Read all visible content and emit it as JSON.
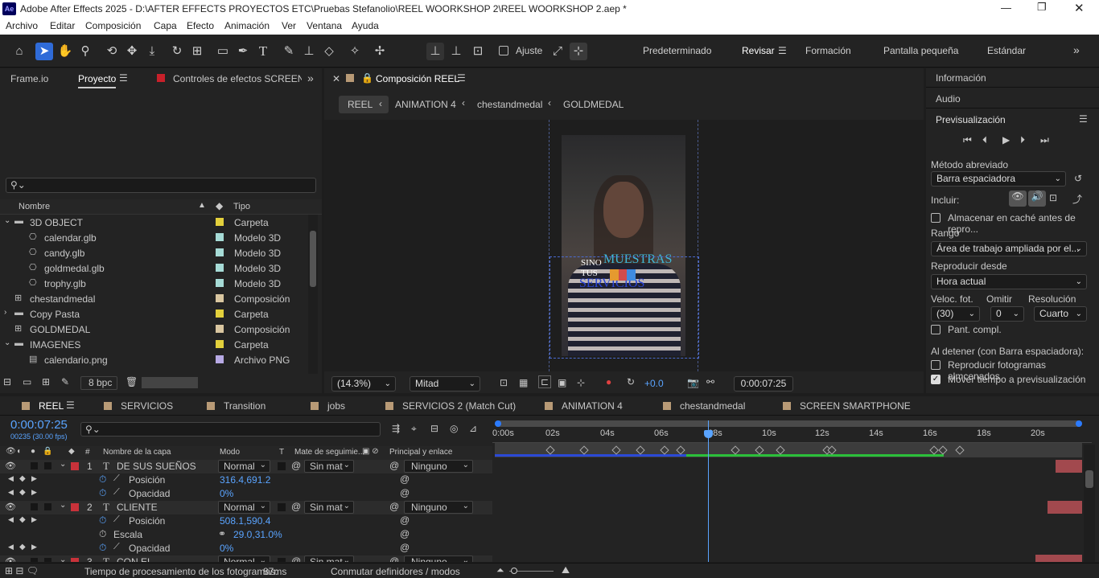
{
  "window": {
    "title": "Adobe After Effects 2025 - D:\\AFTER EFFECTS PROYECTOS ETC\\Pruebas Stefanolio\\REEL WOORKSHOP 2\\REEL WOORKSHOP 2.aep *",
    "app_badge": "Ae"
  },
  "menu": [
    "Archivo",
    "Editar",
    "Composición",
    "Capa",
    "Efecto",
    "Animación",
    "Ver",
    "Ventana",
    "Ayuda"
  ],
  "toolbar": {
    "snap_label": "Ajuste",
    "workspaces": [
      "Predeterminado",
      "Revisar",
      "Formación",
      "Pantalla pequeña",
      "Estándar"
    ],
    "active_workspace": "Revisar"
  },
  "project": {
    "tabs": [
      "Frame.io",
      "Proyecto",
      "Controles de efectos SCREEN SMA"
    ],
    "active_tab": "Proyecto",
    "search_placeholder": "",
    "col_name": "Nombre",
    "col_type": "Tipo",
    "items": [
      {
        "name": "3D OBJECT",
        "type": "Carpeta",
        "color": "#e3d03c",
        "indent": 0,
        "expand": "open",
        "icon": "folder-icon"
      },
      {
        "name": "calendar.glb",
        "type": "Modelo 3D",
        "color": "#a6dbd6",
        "indent": 1,
        "expand": "",
        "icon": "model-icon"
      },
      {
        "name": "candy.glb",
        "type": "Modelo 3D",
        "color": "#a6dbd6",
        "indent": 1,
        "expand": "",
        "icon": "model-icon"
      },
      {
        "name": "goldmedal.glb",
        "type": "Modelo 3D",
        "color": "#a6dbd6",
        "indent": 1,
        "expand": "",
        "icon": "model-icon"
      },
      {
        "name": "trophy.glb",
        "type": "Modelo 3D",
        "color": "#a6dbd6",
        "indent": 1,
        "expand": "",
        "icon": "model-icon"
      },
      {
        "name": "chestandmedal",
        "type": "Composición",
        "color": "#d9c6a0",
        "indent": 0,
        "expand": "",
        "icon": "comp-icon"
      },
      {
        "name": "Copy Pasta",
        "type": "Carpeta",
        "color": "#e3d03c",
        "indent": 0,
        "expand": "closed",
        "icon": "folder-icon"
      },
      {
        "name": "GOLDMEDAL",
        "type": "Composición",
        "color": "#d9c6a0",
        "indent": 0,
        "expand": "",
        "icon": "comp-icon"
      },
      {
        "name": "IMAGENES",
        "type": "Carpeta",
        "color": "#e3d03c",
        "indent": 0,
        "expand": "open",
        "icon": "folder-icon"
      },
      {
        "name": "calendario.png",
        "type": "Archivo PNG",
        "color": "#b7a9e4",
        "indent": 1,
        "expand": "",
        "icon": "image-icon"
      }
    ],
    "bpc": "8 bpc"
  },
  "composition": {
    "tab_title": "Composición REEL",
    "breadcrumbs": [
      "REEL",
      "ANIMATION 4",
      "chestandmedal",
      "GOLDMEDAL"
    ],
    "overlay_text": {
      "line1": "SINO",
      "line2": "TUS",
      "muestras": "MUESTRAS",
      "servicios": "SERVICIOS"
    },
    "zoom": "(14.3%)",
    "resolution": "Mitad",
    "exposure": "+0.0",
    "timecode": "0:00:07:25"
  },
  "right_panel": {
    "items": [
      "Información",
      "Audio"
    ],
    "preview_title": "Previsualización",
    "shortcut_label": "Método abreviado",
    "shortcut_value": "Barra espaciadora",
    "include_label": "Incluir:",
    "cache_label": "Almacenar en caché antes de repro...",
    "range_label": "Rango",
    "range_value": "Área de trabajo ampliada por el...",
    "play_from_label": "Reproducir desde",
    "play_from_value": "Hora actual",
    "fps_label": "Veloc. fot.",
    "skip_label": "Omitir",
    "res_label": "Resolución",
    "fps_value": "(30)",
    "skip_value": "0",
    "res_value": "Cuarto",
    "fullscreen_label": "Pant. compl.",
    "on_stop_label": "Al detener (con Barra espaciadora):",
    "cached_frames_label": "Reproducir fotogramas almcenados",
    "move_time_label": "Mover tiempo a previsualización"
  },
  "timeline": {
    "tabs": [
      {
        "name": "REEL",
        "color": "#b89a76"
      },
      {
        "name": "SERVICIOS",
        "color": "#b89a76"
      },
      {
        "name": "Transition",
        "color": "#b89a76"
      },
      {
        "name": "jobs",
        "color": "#b89a76"
      },
      {
        "name": "SERVICIOS 2 (Match Cut)",
        "color": "#b89a76"
      },
      {
        "name": "ANIMATION 4",
        "color": "#b89a76"
      },
      {
        "name": "chestandmedal",
        "color": "#b89a76"
      },
      {
        "name": "SCREEN SMARTPHONE",
        "color": "#b89a76"
      }
    ],
    "timecode": "0:00:07:25",
    "frame_info": "00235 (30.00 fps)",
    "col_layer": "Nombre de la capa",
    "col_mode": "Modo",
    "col_t": "T",
    "col_track": "Mate de seguimie...",
    "col_parent": "Principal y enlace",
    "ruler": [
      "0:00s",
      "02s",
      "04s",
      "06s",
      "08s",
      "10s",
      "12s",
      "14s",
      "16s",
      "18s",
      "20s"
    ],
    "layers": [
      {
        "kind": "layer",
        "num": "1",
        "name": "DE SUS SUEÑOS",
        "mode": "Normal",
        "track": "Sin mat",
        "parent": "Ninguno"
      },
      {
        "kind": "prop",
        "name": "Posición",
        "value": "316.4,691.2"
      },
      {
        "kind": "prop",
        "name": "Opacidad",
        "value": "0%"
      },
      {
        "kind": "layer",
        "num": "2",
        "name": "CLIENTE",
        "mode": "Normal",
        "track": "Sin mat",
        "parent": "Ninguno"
      },
      {
        "kind": "prop",
        "name": "Posición",
        "value": "508.1,590.4"
      },
      {
        "kind": "prop",
        "name": "Escala",
        "value": "29.0,31.0%"
      },
      {
        "kind": "prop",
        "name": "Opacidad",
        "value": "0%"
      },
      {
        "kind": "layer",
        "num": "3",
        "name": "CON EL",
        "mode": "Normal",
        "track": "Sin mat",
        "parent": "Ninguno"
      }
    ]
  },
  "statusbar": {
    "render_label": "Tiempo de procesamiento de los fotogramas:",
    "render_value": "87ms",
    "toggle_label": "Conmutar definidores / modos"
  }
}
